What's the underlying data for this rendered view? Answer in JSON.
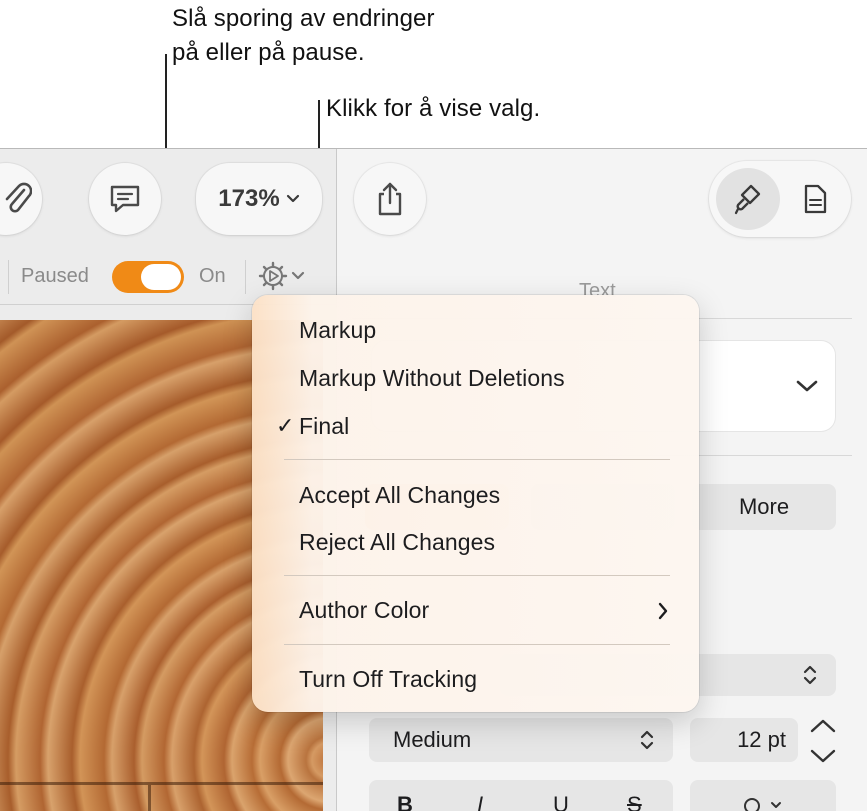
{
  "callouts": {
    "tracking": {
      "line1": "Slå sporing av endringer",
      "line2": "på eller på pause."
    },
    "options": {
      "text": "Klikk for å vise valg."
    }
  },
  "toolbar": {
    "zoom": "173%",
    "attach_icon": "paperclip-icon",
    "comment_icon": "comment-icon",
    "share_icon": "share-icon",
    "format_icon": "paintbrush-icon",
    "document_icon": "document-icon"
  },
  "tracking_bar": {
    "paused_label": "Paused",
    "on_label": "On",
    "toggle_on": true,
    "accent_color": "#f08a16",
    "options_icon": "gear-icon"
  },
  "inspector": {
    "section_title": "Text",
    "more_button": "More",
    "font_weight": "Medium",
    "font_size": "12 pt",
    "style_buttons": [
      "B",
      "I",
      "U",
      "S"
    ]
  },
  "menu": {
    "items": [
      {
        "label": "Markup",
        "checked": false
      },
      {
        "label": "Markup Without Deletions",
        "checked": false
      },
      {
        "label": "Final",
        "checked": true
      }
    ],
    "actions": [
      "Accept All Changes",
      "Reject All Changes"
    ],
    "author_color": "Author Color",
    "turn_off": "Turn Off Tracking"
  }
}
